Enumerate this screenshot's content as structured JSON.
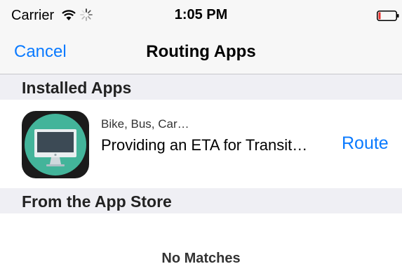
{
  "status_bar": {
    "carrier": "Carrier",
    "time": "1:05 PM",
    "icons": [
      "wifi-icon",
      "activity-indicator-icon",
      "battery-icon"
    ],
    "battery_color": "#e8322f"
  },
  "nav": {
    "cancel_label": "Cancel",
    "title": "Routing Apps"
  },
  "sections": {
    "installed_header": "Installed Apps",
    "store_header": "From the App Store"
  },
  "installed_apps": [
    {
      "subtitle": "Bike, Bus, Car…",
      "title": "Providing an ETA for Transit…",
      "action_label": "Route",
      "icon": "computer-monitor-icon"
    }
  ],
  "store_results": {
    "empty_text": "No Matches"
  },
  "colors": {
    "accent": "#0a7aff",
    "section_background": "#efeff4",
    "app_icon_circle": "#43b49a"
  }
}
